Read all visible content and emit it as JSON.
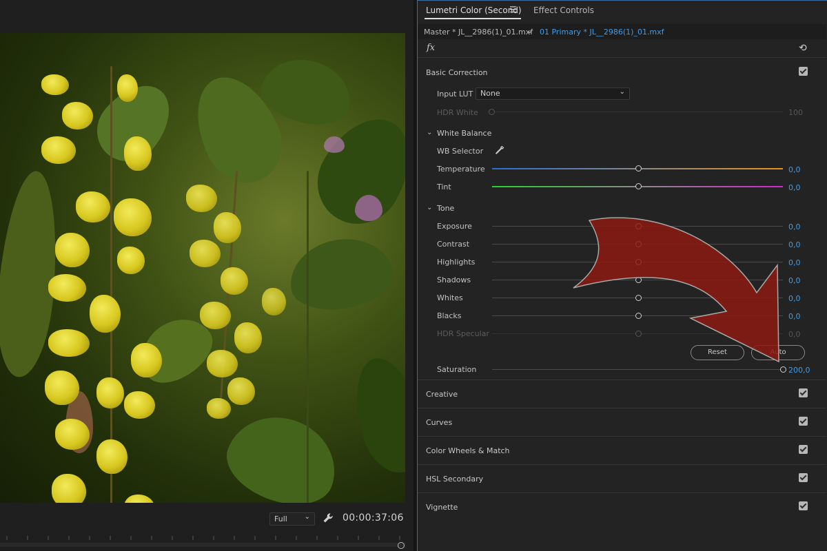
{
  "monitor": {
    "zoom": "Full",
    "timecode": "00:00:37:06"
  },
  "panel": {
    "tabs": [
      {
        "label": "Lumetri Color (Second)"
      },
      {
        "label": "Effect Controls"
      }
    ],
    "master_clip": "Master * JL__2986(1)_01.mxf",
    "sequence_clip": "01 Primary * JL__2986(1)_01.mxf",
    "fx_label": "fx"
  },
  "basic_correction": {
    "title": "Basic Correction",
    "input_lut_label": "Input LUT",
    "input_lut_value": "None",
    "hdr_white_label": "HDR White",
    "hdr_white_value": "100",
    "white_balance": {
      "title": "White Balance",
      "wb_selector_label": "WB Selector",
      "temperature_label": "Temperature",
      "temperature_value": "0,0",
      "tint_label": "Tint",
      "tint_value": "0,0"
    },
    "tone": {
      "title": "Tone",
      "rows": [
        {
          "label": "Exposure",
          "value": "0,0"
        },
        {
          "label": "Contrast",
          "value": "0,0"
        },
        {
          "label": "Highlights",
          "value": "0,0"
        },
        {
          "label": "Shadows",
          "value": "0,0"
        },
        {
          "label": "Whites",
          "value": "0,0"
        },
        {
          "label": "Blacks",
          "value": "0,0"
        },
        {
          "label": "HDR Specular",
          "value": "0,0"
        }
      ],
      "reset_label": "Reset",
      "auto_label": "Auto"
    },
    "saturation_label": "Saturation",
    "saturation_value": "200,0"
  },
  "sections": [
    {
      "title": "Creative"
    },
    {
      "title": "Curves"
    },
    {
      "title": "Color Wheels & Match"
    },
    {
      "title": "HSL Secondary"
    },
    {
      "title": "Vignette"
    }
  ],
  "colors": {
    "accent": "#3f9de6",
    "annotation_arrow": "#8b1a12"
  }
}
